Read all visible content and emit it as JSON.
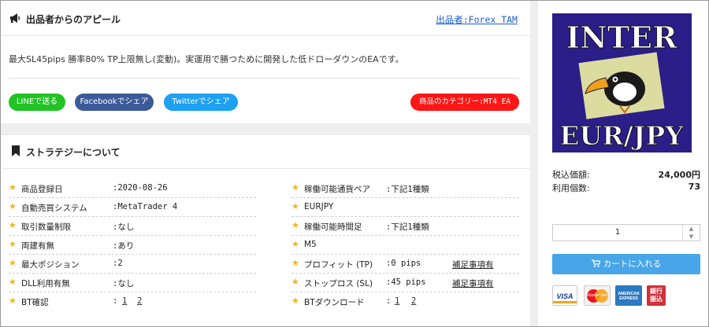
{
  "appeal": {
    "title": "出品者からのアピール",
    "seller_link": "出品者:Forex TAM",
    "description": "最大SL45pips 勝率80% TP上限無し(変動)。実運用で勝つために開発した低ドローダウンのEAです。",
    "buttons": {
      "line": "LINEで送る",
      "facebook": "Facebookでシェア",
      "twitter": "Twitterでシェア"
    },
    "category": "商品のカテゴリー:MT4 EA",
    "colors": {
      "line": "#22c324",
      "facebook": "#3c5a99",
      "twitter": "#1da1f2",
      "category": "#ff1616"
    }
  },
  "strategy": {
    "title": "ストラテジーについて",
    "left": [
      {
        "label": "商品登録日",
        "value": ":2020-08-26"
      },
      {
        "label": "自動売買システム",
        "value": ":MetaTrader 4"
      },
      {
        "label": "取引数量制限",
        "value": ":なし"
      },
      {
        "label": "両建有無",
        "value": ":あり"
      },
      {
        "label": "最大ポジション",
        "value": ":2"
      },
      {
        "label": "DLL利用有無",
        "value": ":なし"
      },
      {
        "label": "BT確認",
        "value": ":",
        "links": [
          "1",
          "2"
        ]
      }
    ],
    "right": [
      {
        "label": "稼働可能通貨ペア",
        "value": ":下記1種類"
      },
      {
        "label": "EURJPY",
        "value": ""
      },
      {
        "label": "稼働可能時間足",
        "value": ":下記1種類"
      },
      {
        "label": "M5",
        "value": ""
      },
      {
        "label": "プロフィット (TP)",
        "value": ":0 pips",
        "extra": "補足事項有"
      },
      {
        "label": "ストップロス (SL)",
        "value": ":45 pips",
        "extra": "補足事項有"
      },
      {
        "label": "BTダウンロード",
        "value": ":",
        "links": [
          "1",
          "2"
        ]
      }
    ]
  },
  "product": {
    "image_text_top": "INTER",
    "image_text_bottom": "EUR/JPY",
    "price_label": "税込価額:",
    "price_value": "24,000円",
    "count_label": "利用個数:",
    "count_value": "73",
    "quantity": "1",
    "cart_button": "カートに入れる",
    "payment_cards": [
      "VISA",
      "MasterCard",
      "AMERICAN EXPRESS",
      "銀行振込"
    ],
    "icons": {
      "appeal": "megaphone-icon",
      "strategy": "bookmark-icon",
      "cart": "cart-icon"
    }
  }
}
